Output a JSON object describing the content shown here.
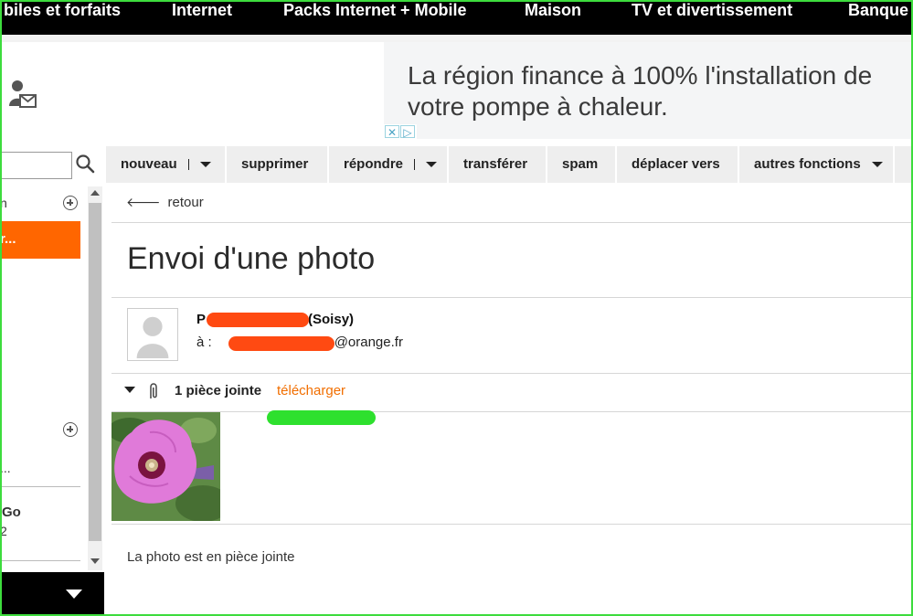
{
  "topnav": {
    "items": [
      "biles et forfaits",
      "Internet",
      "Packs Internet + Mobile",
      "Maison",
      "TV et divertissement",
      "Banque"
    ]
  },
  "ad": {
    "text": "La région finance à 100% l'installation de votre pompe à chaleur."
  },
  "search": {
    "value": "",
    "placeholder": ""
  },
  "toolbar": {
    "nouveau": "nouveau",
    "supprimer": "supprimer",
    "repondre": "répondre",
    "transferer": "transférer",
    "spam": "spam",
    "deplacer": "déplacer vers",
    "autres": "autres fonctions"
  },
  "sidebar": {
    "item1": "n",
    "selected": "r...",
    "item2": "...",
    "item3_title": "Go",
    "item3_sub": "2"
  },
  "message": {
    "back_label": "retour",
    "subject": "Envoi d'une photo",
    "from_prefix": "P",
    "from_suffix": "(Soisy)",
    "to_prefix": "à :",
    "to_suffix": "@orange.fr",
    "attachment_count": "1 pièce jointe",
    "download_label": "télécharger",
    "body": "La photo est en pièce jointe"
  },
  "colors": {
    "brand_orange": "#ff6600",
    "download_orange": "#f16e00",
    "redact_red": "#ff4a12",
    "highlight_green": "#2ee02e",
    "border_green": "#3ddc3d"
  }
}
